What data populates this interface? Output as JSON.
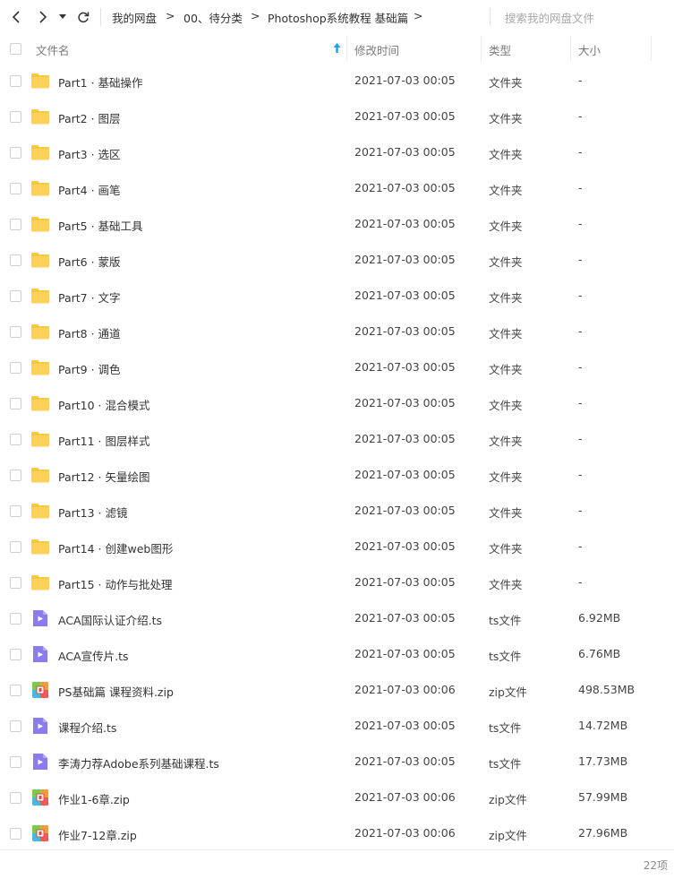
{
  "nav": {
    "back_icon": "chevron-left-icon",
    "forward_icon": "chevron-right-icon",
    "dropdown_icon": "caret-down-icon",
    "refresh_icon": "refresh-icon"
  },
  "breadcrumb": [
    {
      "label": "我的网盘"
    },
    {
      "label": "00、待分类"
    },
    {
      "label": "Photoshop系统教程 基础篇"
    }
  ],
  "breadcrumb_separator": ">",
  "search": {
    "placeholder": "搜索我的网盘文件"
  },
  "columns": {
    "name": "文件名",
    "modified": "修改时间",
    "type": "类型",
    "size": "大小"
  },
  "colors": {
    "folder": "#ffc83d",
    "video": "#8a7cf0",
    "zip": "#f0a030",
    "sort_arrow": "#1aa3e8"
  },
  "files": [
    {
      "name": "Part1 · 基础操作",
      "modified": "2021-07-03 00:05",
      "type": "文件夹",
      "size": "-",
      "icon": "folder"
    },
    {
      "name": "Part2 · 图层",
      "modified": "2021-07-03 00:05",
      "type": "文件夹",
      "size": "-",
      "icon": "folder"
    },
    {
      "name": "Part3 · 选区",
      "modified": "2021-07-03 00:05",
      "type": "文件夹",
      "size": "-",
      "icon": "folder"
    },
    {
      "name": "Part4 · 画笔",
      "modified": "2021-07-03 00:05",
      "type": "文件夹",
      "size": "-",
      "icon": "folder"
    },
    {
      "name": "Part5 · 基础工具",
      "modified": "2021-07-03 00:05",
      "type": "文件夹",
      "size": "-",
      "icon": "folder"
    },
    {
      "name": "Part6 · 蒙版",
      "modified": "2021-07-03 00:05",
      "type": "文件夹",
      "size": "-",
      "icon": "folder"
    },
    {
      "name": "Part7 · 文字",
      "modified": "2021-07-03 00:05",
      "type": "文件夹",
      "size": "-",
      "icon": "folder"
    },
    {
      "name": "Part8 · 通道",
      "modified": "2021-07-03 00:05",
      "type": "文件夹",
      "size": "-",
      "icon": "folder"
    },
    {
      "name": "Part9 · 调色",
      "modified": "2021-07-03 00:05",
      "type": "文件夹",
      "size": "-",
      "icon": "folder"
    },
    {
      "name": "Part10 · 混合模式",
      "modified": "2021-07-03 00:05",
      "type": "文件夹",
      "size": "-",
      "icon": "folder"
    },
    {
      "name": "Part11 · 图层样式",
      "modified": "2021-07-03 00:05",
      "type": "文件夹",
      "size": "-",
      "icon": "folder"
    },
    {
      "name": "Part12 · 矢量绘图",
      "modified": "2021-07-03 00:05",
      "type": "文件夹",
      "size": "-",
      "icon": "folder"
    },
    {
      "name": "Part13 · 滤镜",
      "modified": "2021-07-03 00:05",
      "type": "文件夹",
      "size": "-",
      "icon": "folder"
    },
    {
      "name": "Part14 · 创建web图形",
      "modified": "2021-07-03 00:05",
      "type": "文件夹",
      "size": "-",
      "icon": "folder"
    },
    {
      "name": "Part15 · 动作与批处理",
      "modified": "2021-07-03 00:05",
      "type": "文件夹",
      "size": "-",
      "icon": "folder"
    },
    {
      "name": "ACA国际认证介绍.ts",
      "modified": "2021-07-03 00:05",
      "type": "ts文件",
      "size": "6.92MB",
      "icon": "video"
    },
    {
      "name": "ACA宣传片.ts",
      "modified": "2021-07-03 00:05",
      "type": "ts文件",
      "size": "6.76MB",
      "icon": "video"
    },
    {
      "name": "PS基础篇 课程资料.zip",
      "modified": "2021-07-03 00:06",
      "type": "zip文件",
      "size": "498.53MB",
      "icon": "zip"
    },
    {
      "name": "课程介绍.ts",
      "modified": "2021-07-03 00:05",
      "type": "ts文件",
      "size": "14.72MB",
      "icon": "video"
    },
    {
      "name": "李涛力荐Adobe系列基础课程.ts",
      "modified": "2021-07-03 00:05",
      "type": "ts文件",
      "size": "17.73MB",
      "icon": "video"
    },
    {
      "name": "作业1-6章.zip",
      "modified": "2021-07-03 00:06",
      "type": "zip文件",
      "size": "57.99MB",
      "icon": "zip"
    },
    {
      "name": "作业7-12章.zip",
      "modified": "2021-07-03 00:06",
      "type": "zip文件",
      "size": "27.96MB",
      "icon": "zip"
    }
  ],
  "footer": {
    "count": "22项"
  }
}
